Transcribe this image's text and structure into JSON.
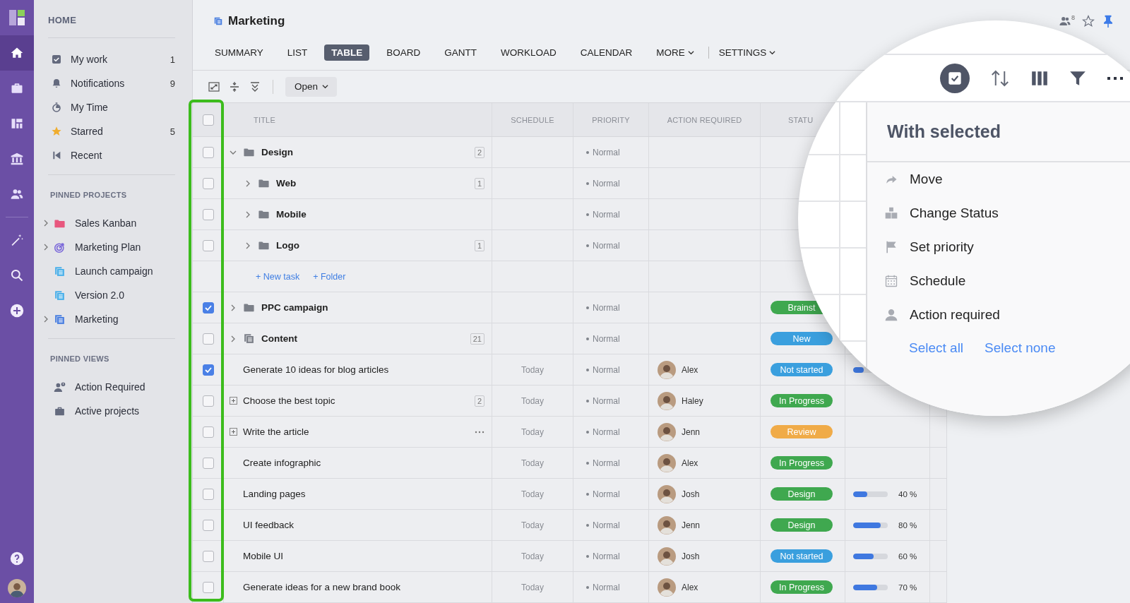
{
  "rail": {
    "nav": [
      {
        "kind": "home",
        "selected": true
      },
      {
        "kind": "briefcase",
        "selected": false
      },
      {
        "kind": "board",
        "selected": false
      },
      {
        "kind": "bank",
        "selected": false
      },
      {
        "kind": "people",
        "selected": false
      }
    ],
    "tools": [
      {
        "kind": "wand"
      },
      {
        "kind": "search"
      },
      {
        "kind": "add"
      }
    ],
    "bottom": [
      {
        "kind": "help"
      },
      {
        "kind": "user"
      }
    ]
  },
  "sidebar": {
    "heading": "HOME",
    "items": [
      {
        "kind": "check",
        "label": "My work",
        "count": "1"
      },
      {
        "kind": "bell",
        "label": "Notifications",
        "count": "9"
      },
      {
        "kind": "timer",
        "label": "My Time"
      },
      {
        "kind": "star",
        "label": "Starred",
        "count": "5"
      },
      {
        "kind": "recent",
        "label": "Recent"
      }
    ],
    "sections": [
      {
        "heading": "PINNED PROJECTS",
        "items": [
          {
            "kind": "folder",
            "label": "Sales Kanban",
            "color": "#e8577e",
            "expandable": true
          },
          {
            "kind": "target",
            "label": "Marketing Plan",
            "color": "#7b68d9",
            "expandable": true
          },
          {
            "kind": "list",
            "label": "Launch campaign",
            "color": "#4ab0ea",
            "expandable": false
          },
          {
            "kind": "list",
            "label": "Version 2.0",
            "color": "#4ab0ea",
            "expandable": false
          },
          {
            "kind": "list",
            "label": "Marketing",
            "color": "#4a7fe0",
            "expandable": true
          }
        ]
      },
      {
        "heading": "PINNED VIEWS",
        "items": [
          {
            "kind": "person-alert",
            "label": "Action Required",
            "expandable": false
          },
          {
            "kind": "briefcase",
            "label": "Active projects",
            "expandable": false
          }
        ]
      }
    ]
  },
  "header": {
    "title": "Marketing",
    "members": "8",
    "starred": false,
    "pinned": true
  },
  "tabs": [
    {
      "label": "SUMMARY",
      "selected": false,
      "dropdown": false,
      "separated": false
    },
    {
      "label": "LIST",
      "selected": false,
      "dropdown": false,
      "separated": false
    },
    {
      "label": "TABLE",
      "selected": true,
      "dropdown": false,
      "separated": false
    },
    {
      "label": "BOARD",
      "selected": false,
      "dropdown": false,
      "separated": false
    },
    {
      "label": "GANTT",
      "selected": false,
      "dropdown": false,
      "separated": false
    },
    {
      "label": "WORKLOAD",
      "selected": false,
      "dropdown": false,
      "separated": false
    },
    {
      "label": "CALENDAR",
      "selected": false,
      "dropdown": false,
      "separated": false
    },
    {
      "label": "MORE",
      "selected": false,
      "dropdown": true,
      "separated": false
    },
    {
      "label": "SETTINGS",
      "selected": false,
      "dropdown": true,
      "separated": true
    }
  ],
  "toolbar": {
    "filter": "Open"
  },
  "table": {
    "columns": [
      "TITLE",
      "SCHEDULE",
      "PRIORITY",
      "ACTION REQUIRED",
      "STATU"
    ],
    "all_checked": false,
    "checkbox_highlight": true,
    "rows": [
      {
        "kind": "folder",
        "title": "Design",
        "count": "2",
        "checked": false,
        "expanded": true,
        "priority": "Normal",
        "children": [
          {
            "kind": "folder",
            "title": "Web",
            "count": "1",
            "checked": false,
            "expanded": false,
            "priority": "Normal"
          },
          {
            "kind": "folder",
            "title": "Mobile",
            "checked": false,
            "expanded": false,
            "priority": "Normal"
          },
          {
            "kind": "folder",
            "title": "Logo",
            "count": "1",
            "checked": false,
            "expanded": false,
            "priority": "Normal"
          },
          {
            "kind": "add",
            "links": [
              "+ New task",
              "+ Folder"
            ]
          }
        ]
      },
      {
        "kind": "folder",
        "title": "PPC campaign",
        "checked": true,
        "expanded": false,
        "priority": "Normal",
        "status": "Brainst",
        "color": "#3fa84f"
      },
      {
        "kind": "list",
        "title": "Content",
        "count": "21",
        "checked": false,
        "expanded": false,
        "priority": "Normal",
        "status": "New",
        "color": "#3a9fde"
      },
      {
        "kind": "task",
        "title": "Generate 10 ideas for blog articles",
        "checked": true,
        "subtasks": false,
        "actions_menu": false,
        "schedule": "Today",
        "priority": "Normal",
        "assignee": "Alex",
        "status": "Not started",
        "color": "#3a9fde",
        "level": 0.3
      },
      {
        "kind": "task",
        "title": "Choose the best topic",
        "count": "2",
        "checked": false,
        "subtasks": true,
        "actions_menu": false,
        "schedule": "Today",
        "priority": "Normal",
        "assignee": "Haley",
        "status": "In Progress",
        "color": "#3fa84f"
      },
      {
        "kind": "task",
        "title": "Write the article",
        "checked": false,
        "subtasks": true,
        "actions_menu": true,
        "schedule": "Today",
        "priority": "Normal",
        "assignee": "Jenn",
        "status": "Review",
        "color": "#f0ab48"
      },
      {
        "kind": "task",
        "title": "Create infographic",
        "checked": false,
        "subtasks": false,
        "actions_menu": false,
        "schedule": "Today",
        "priority": "Normal",
        "assignee": "Alex",
        "status": "In Progress",
        "color": "#3fa84f"
      },
      {
        "kind": "task",
        "title": "Landing pages",
        "checked": false,
        "subtasks": false,
        "actions_menu": false,
        "schedule": "Today",
        "priority": "Normal",
        "assignee": "Josh",
        "status": "Design",
        "color": "#3fa84f",
        "level": 0.4,
        "reading": "40 %"
      },
      {
        "kind": "task",
        "title": "UI feedback",
        "checked": false,
        "subtasks": false,
        "actions_menu": false,
        "schedule": "Today",
        "priority": "Normal",
        "assignee": "Jenn",
        "status": "Design",
        "color": "#3fa84f",
        "level": 0.8,
        "reading": "80 %"
      },
      {
        "kind": "task",
        "title": "Mobile UI",
        "checked": false,
        "subtasks": false,
        "actions_menu": false,
        "schedule": "Today",
        "priority": "Normal",
        "assignee": "Josh",
        "status": "Not started",
        "color": "#3a9fde",
        "level": 0.6,
        "reading": "60 %"
      },
      {
        "kind": "task",
        "title": "Generate ideas for a new brand book",
        "checked": false,
        "subtasks": false,
        "actions_menu": false,
        "schedule": "Today",
        "priority": "Normal",
        "assignee": "Alex",
        "status": "In Progress",
        "color": "#3fa84f",
        "level": 0.7,
        "reading": "70 %"
      }
    ]
  },
  "with_selected": {
    "select_mode": true,
    "title": "With selected",
    "actions": [
      {
        "kind": "move",
        "label": "Move"
      },
      {
        "kind": "status",
        "label": "Change Status"
      },
      {
        "kind": "flag",
        "label": "Set priority"
      },
      {
        "kind": "calendar",
        "label": "Schedule"
      },
      {
        "kind": "person",
        "label": "Action required"
      }
    ],
    "links": [
      "Select all",
      "Select none"
    ]
  }
}
